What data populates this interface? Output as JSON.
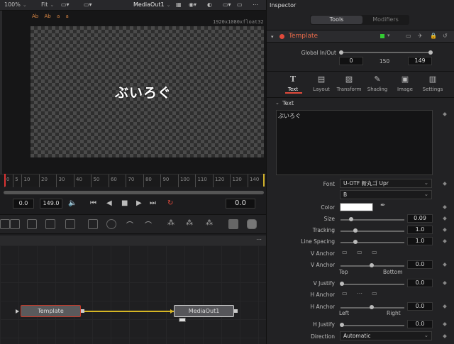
{
  "topbar": {
    "zoom": "100%",
    "fit": "Fit",
    "viewer_title": "MediaOut1"
  },
  "viewer": {
    "resolution": "1920x1080xfloat32",
    "canvas_text": "ぶいろぐ",
    "overlay_labels": [
      "Ab",
      "Ab",
      "a",
      "a"
    ]
  },
  "timeline": {
    "ticks": [
      "0",
      "5",
      "10",
      "20",
      "30",
      "40",
      "50",
      "60",
      "70",
      "80",
      "90",
      "100",
      "110",
      "120",
      "130",
      "140"
    ],
    "current": "0.0",
    "end": "149.0",
    "time_display": "0.0"
  },
  "flow": {
    "node_template": "Template",
    "node_mediaout": "MediaOut1"
  },
  "inspector": {
    "title": "Inspector",
    "tabs": {
      "tools": "Tools",
      "modifiers": "Modifiers"
    },
    "node_name": "Template",
    "global_in_out": {
      "label": "Global In/Out",
      "start": "0",
      "mid": "150",
      "end": "149"
    },
    "subtabs": [
      "Text",
      "Layout",
      "Transform",
      "Shading",
      "Image",
      "Settings"
    ],
    "section": "Text",
    "styled_text": "ぶいろぐ",
    "font_label": "Font",
    "font": "U-OTF 新丸ゴ Upr",
    "font_style": "B",
    "color_label": "Color",
    "size": {
      "label": "Size",
      "value": "0.09"
    },
    "tracking": {
      "label": "Tracking",
      "value": "1.0"
    },
    "line_spacing": {
      "label": "Line Spacing",
      "value": "1.0"
    },
    "v_anchor_label": "V Anchor",
    "v_anchor": {
      "label": "V Anchor",
      "value": "0.0",
      "left": "Top",
      "right": "Bottom"
    },
    "v_justify": {
      "label": "V Justify",
      "value": "0.0"
    },
    "h_anchor_label": "H Anchor",
    "h_anchor": {
      "label": "H Anchor",
      "value": "0.0",
      "left": "Left",
      "right": "Right"
    },
    "h_justify": {
      "label": "H Justify",
      "value": "0.0"
    },
    "direction": {
      "label": "Direction",
      "value": "Automatic"
    }
  },
  "colors": {
    "accent_red": "#e24a3b",
    "connector": "#d6b624",
    "tab_active": "#3a3a3e"
  }
}
